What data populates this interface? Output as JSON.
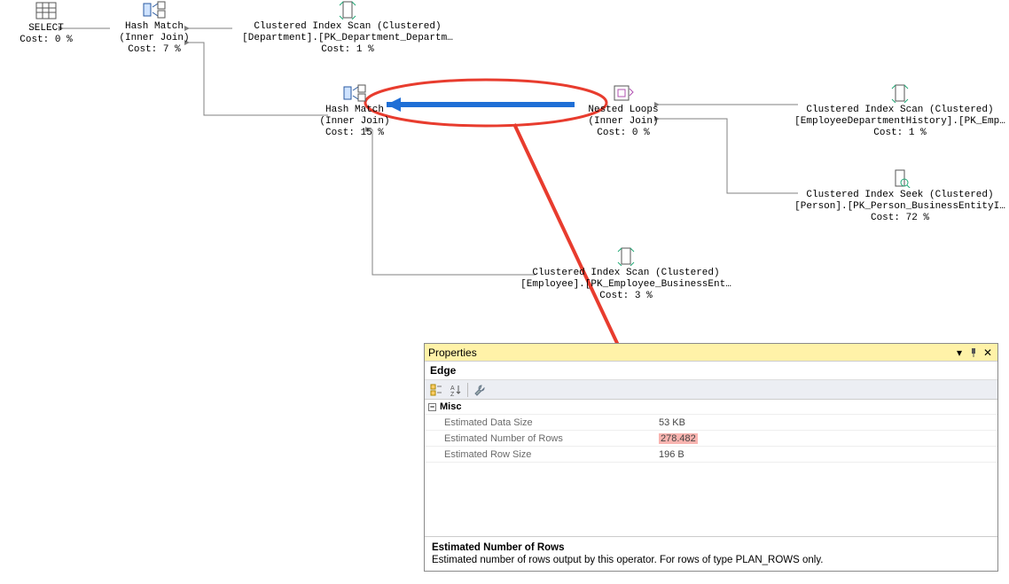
{
  "nodes": {
    "select": {
      "l1": "SELECT",
      "l2": "Cost: 0 %"
    },
    "hm1": {
      "l1": "Hash Match",
      "l2": "(Inner Join)",
      "l3": "Cost: 7 %"
    },
    "cis_dep": {
      "l1": "Clustered Index Scan (Clustered)",
      "l2": "[Department].[PK_Department_Departm…",
      "l3": "Cost: 1 %"
    },
    "hm2": {
      "l1": "Hash Match",
      "l2": "(Inner Join)",
      "l3": "Cost: 15 %"
    },
    "nl": {
      "l1": "Nested Loops",
      "l2": "(Inner Join)",
      "l3": "Cost: 0 %"
    },
    "cis_edh": {
      "l1": "Clustered Index Scan (Clustered)",
      "l2": "[EmployeeDepartmentHistory].[PK_Emp…",
      "l3": "Cost: 1 %"
    },
    "seek_p": {
      "l1": "Clustered Index Seek (Clustered)",
      "l2": "[Person].[PK_Person_BusinessEntityI…",
      "l3": "Cost: 72 %"
    },
    "cis_emp": {
      "l1": "Clustered Index Scan (Clustered)",
      "l2": "[Employee].[PK_Employee_BusinessEnt…",
      "l3": "Cost: 3 %"
    }
  },
  "props": {
    "title": "Properties",
    "subtitle": "Edge",
    "section": "Misc",
    "rows": [
      {
        "name": "Estimated Data Size",
        "value": "53 KB"
      },
      {
        "name": "Estimated Number of Rows",
        "value": "278.482",
        "hl": true
      },
      {
        "name": "Estimated Row Size",
        "value": "196 B"
      }
    ],
    "desc": {
      "title": "Estimated Number of Rows",
      "body": "Estimated number of rows output by this operator. For rows of type PLAN_ROWS only."
    }
  }
}
